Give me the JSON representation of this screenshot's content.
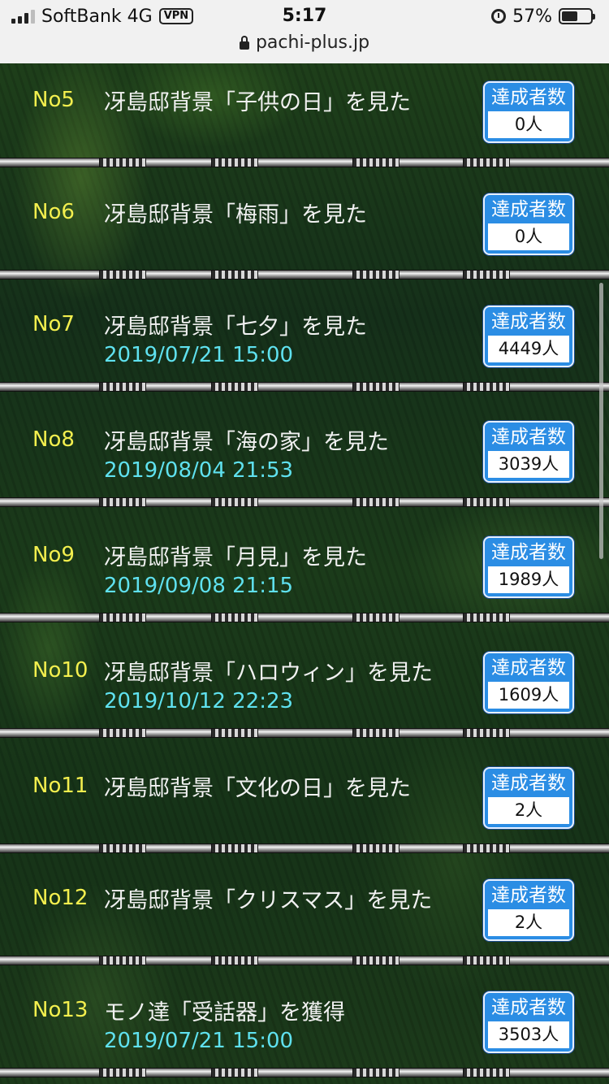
{
  "status": {
    "carrier": "SoftBank 4G",
    "vpn": "VPN",
    "time": "5:17",
    "battery": "57%",
    "battery_level": 0.57
  },
  "url": "pachi-plus.jp",
  "badge_label": "達成者数",
  "items": [
    {
      "no": "No5",
      "title": "冴島邸背景「子供の日」を見た",
      "date": "",
      "count": "0人"
    },
    {
      "no": "No6",
      "title": "冴島邸背景「梅雨」を見た",
      "date": "",
      "count": "0人"
    },
    {
      "no": "No7",
      "title": "冴島邸背景「七夕」を見た",
      "date": "2019/07/21 15:00",
      "count": "4449人"
    },
    {
      "no": "No8",
      "title": "冴島邸背景「海の家」を見た",
      "date": "2019/08/04 21:53",
      "count": "3039人"
    },
    {
      "no": "No9",
      "title": "冴島邸背景「月見」を見た",
      "date": "2019/09/08 21:15",
      "count": "1989人"
    },
    {
      "no": "No10",
      "title": "冴島邸背景「ハロウィン」を見た",
      "date": "2019/10/12 22:23",
      "count": "1609人"
    },
    {
      "no": "No11",
      "title": "冴島邸背景「文化の日」を見た",
      "date": "",
      "count": "2人"
    },
    {
      "no": "No12",
      "title": "冴島邸背景「クリスマス」を見た",
      "date": "",
      "count": "2人"
    },
    {
      "no": "No13",
      "title": "モノ達「受話器」を獲得",
      "date": "2019/07/21 15:00",
      "count": "3503人"
    }
  ]
}
